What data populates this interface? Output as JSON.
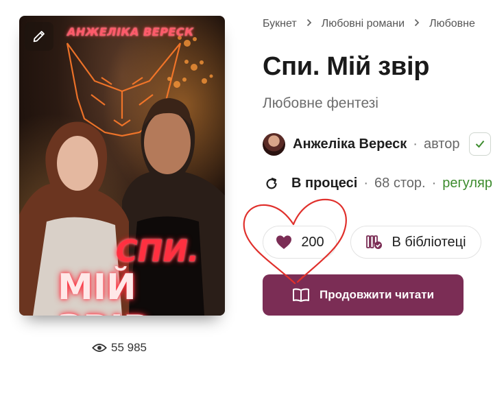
{
  "cover": {
    "author_lettering": "АНЖЕЛІКА ВЕРЕСК",
    "title_line_1": "СПИ.",
    "title_line_2": "МІЙ ЗВІР",
    "edit_icon": "pencil-icon"
  },
  "stats": {
    "views": "55 985",
    "views_icon": "eye-icon"
  },
  "breadcrumb": [
    "Букнет",
    "Любовні романи",
    "Любовне"
  ],
  "book": {
    "title": "Спи. Мій звір",
    "genre": "Любовне фентезі"
  },
  "author": {
    "name": "Анжеліка Вереск",
    "role": "автор",
    "follow_icon": "check-icon"
  },
  "status": {
    "icon": "refresh-icon",
    "label": "В процесі",
    "pages": "68 стор.",
    "schedule": "регуляр",
    "schedule_color": "#3d8c2e"
  },
  "actions": {
    "likes": "200",
    "like_icon": "heart-icon",
    "library_label": "В бібліотеці",
    "library_icon": "library-check-icon",
    "read_label": "Продовжити читати",
    "read_icon": "open-book-icon"
  },
  "colors": {
    "accent": "#7b2d55",
    "annotation": "#e0302c"
  }
}
